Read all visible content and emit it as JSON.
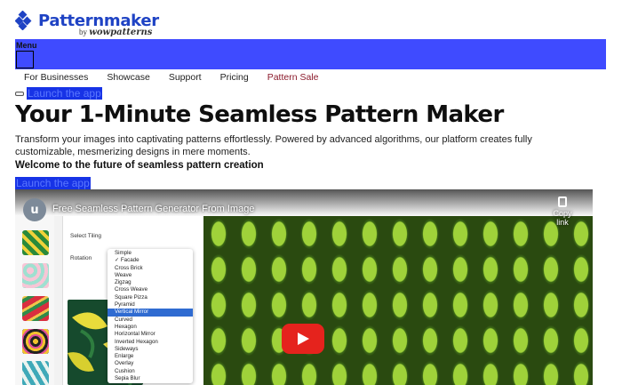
{
  "brand": {
    "name": "Patternmaker",
    "by": "by",
    "by_brand": "wowpatterns"
  },
  "nav": {
    "menu_label": "Menu",
    "links": [
      "For Businesses",
      "Showcase",
      "Support",
      "Pricing",
      "Pattern Sale"
    ]
  },
  "hero": {
    "launch_label": "Launch the app",
    "title": "Your 1-Minute Seamless Pattern Maker",
    "intro": "Transform your images into captivating patterns effortlessly. Powered by advanced algorithms, our platform creates fully customizable, mesmerizing designs in mere moments.",
    "subheading": "Welcome to the future of seamless pattern creation",
    "launch_label_2": "Launch the app"
  },
  "video": {
    "channel_initial": "u",
    "title": "Free Seamless Pattern Generator From Image",
    "copy_link": "Copy link",
    "app": {
      "tiling_label": "Select Tiling",
      "rotation_label": "Rotation",
      "dropdown_items": [
        "Simple",
        "✓ Facade",
        "Cross Brick",
        "Weave",
        "Zigzag",
        "Cross Weave",
        "Square Pizza",
        "Pyramid",
        "Vertical Mirror",
        "Curved",
        "Hexagon",
        "Horizontal Mirror",
        "Inverted Hexagon",
        "Sideways",
        "Enlarge",
        "Overlay",
        "Cushion",
        "Sepia Blur"
      ],
      "selected_item": "Vertical Mirror"
    }
  },
  "colors": {
    "brand_blue": "#1f43c4",
    "nav_bg": "#3f4bff",
    "link_bg": "#1733e6",
    "sale": "#8b1a2b",
    "youtube_red": "#e5231d"
  }
}
